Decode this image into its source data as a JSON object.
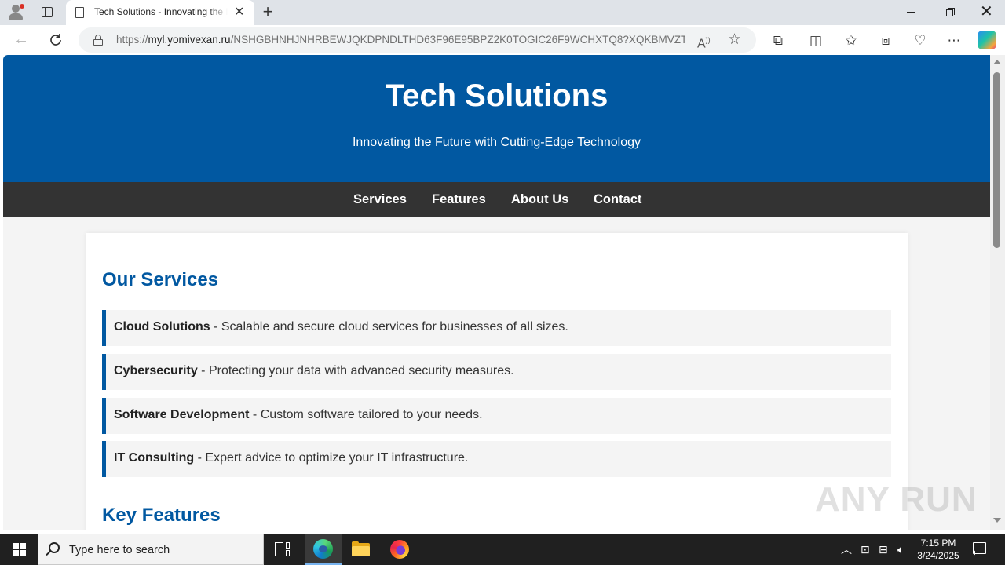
{
  "browser": {
    "tab_title": "Tech Solutions - Innovating the Future with Cutting-Edge Technology",
    "new_tab_label": "+",
    "url_scheme": "https://",
    "url_host": "myl.yomivexan.ru",
    "url_path": "/NSHGBHNHJNHRBEWJQKDPNDLTHD63F96E95BPZ2K0TOGIC26F9WCHXTQ8?XQKBMVZT..."
  },
  "page": {
    "hero_title": "Tech Solutions",
    "hero_subtitle": "Innovating the Future with Cutting-Edge Technology",
    "nav": [
      "Services",
      "Features",
      "About Us",
      "Contact"
    ],
    "services_heading": "Our Services",
    "services": [
      {
        "name": "Cloud Solutions",
        "desc": " - Scalable and secure cloud services for businesses of all sizes."
      },
      {
        "name": "Cybersecurity",
        "desc": " - Protecting your data with advanced security measures."
      },
      {
        "name": "Software Development",
        "desc": " - Custom software tailored to your needs."
      },
      {
        "name": "IT Consulting",
        "desc": " - Expert advice to optimize your IT infrastructure."
      }
    ],
    "features_heading": "Key Features"
  },
  "watermark": "ANY RUN",
  "taskbar": {
    "search_placeholder": "Type here to search",
    "time": "7:15 PM",
    "date": "3/24/2025"
  },
  "colors": {
    "brand_blue": "#0158a1",
    "nav_dark": "#333333"
  }
}
